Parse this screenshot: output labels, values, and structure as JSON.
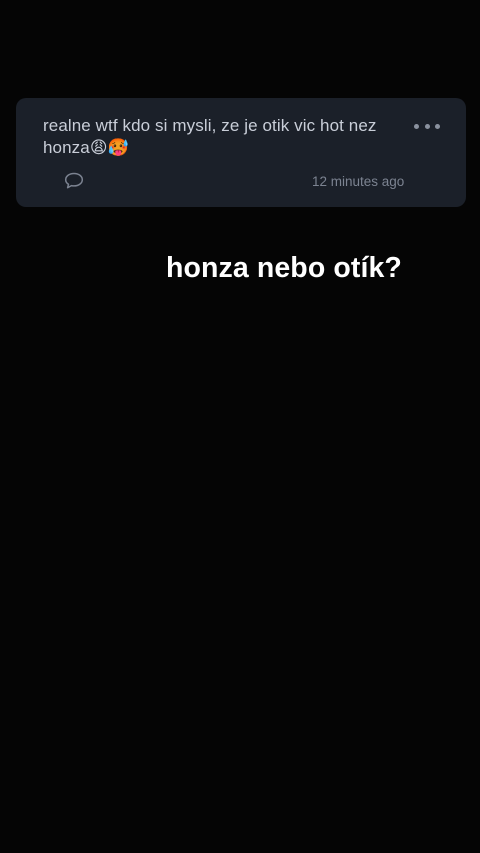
{
  "post": {
    "text": "realne wtf kdo si mysli, ze je otik vic hot nez honza😩🥵",
    "timestamp": "12 minutes ago",
    "more_icon": "ellipsis-icon",
    "reply_icon": "speech-bubble-icon"
  },
  "caption": {
    "text": "honza nebo otík?"
  },
  "colors": {
    "background": "#050505",
    "card": "#1b2029",
    "card_text": "#c9ced8",
    "muted": "#7c8391",
    "caption": "#ffffff"
  }
}
